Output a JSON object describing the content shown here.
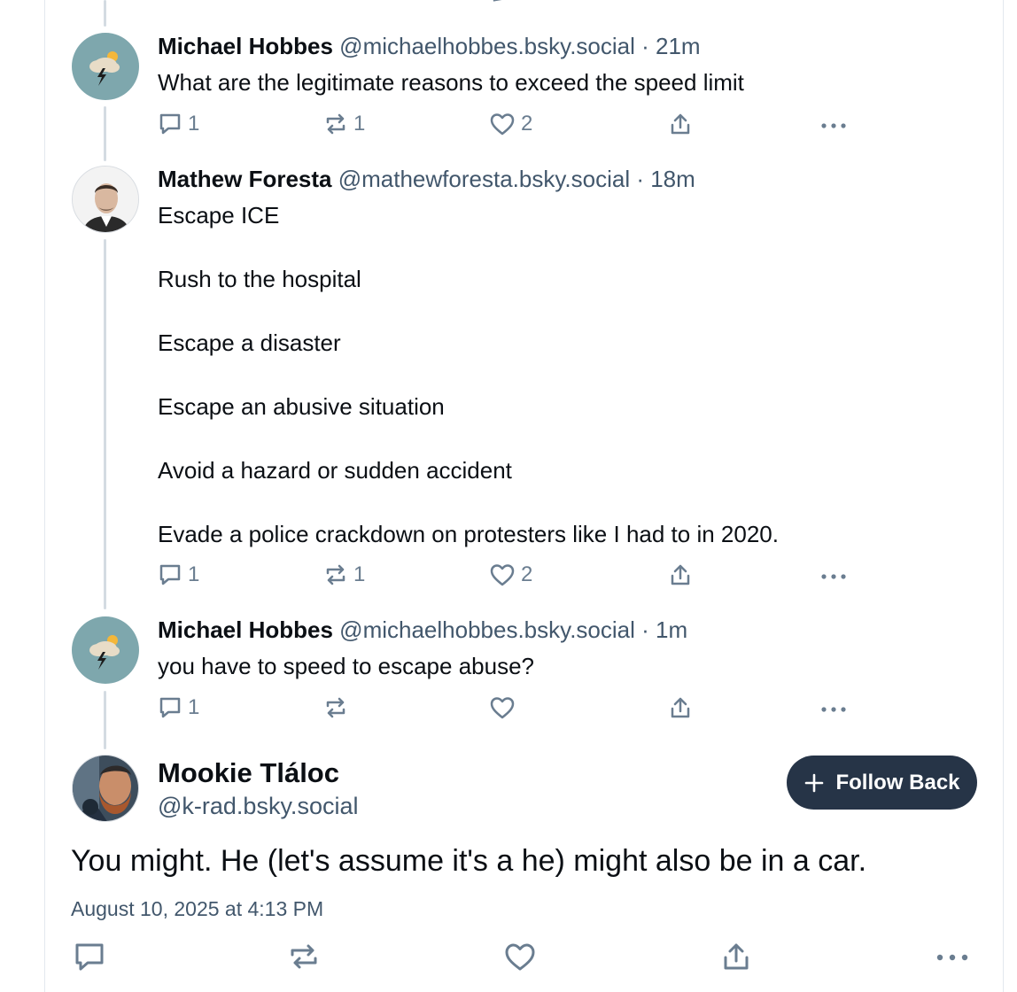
{
  "posts": [
    {
      "author": "Michael Hobbes",
      "handle": "@michaelhobbes.bsky.social",
      "time": "21m",
      "lines": [
        "What are the legitimate reasons to exceed the speed limit"
      ],
      "replies": "1",
      "reposts": "1",
      "likes": "2"
    },
    {
      "author": "Mathew Foresta",
      "handle": "@mathewforesta.bsky.social",
      "time": "18m",
      "lines": [
        "Escape ICE",
        "Rush to the hospital",
        "Escape a disaster",
        "Escape an abusive situation",
        "Avoid a hazard or sudden accident",
        "Evade a police crackdown on protesters like I had to in 2020."
      ],
      "replies": "1",
      "reposts": "1",
      "likes": "2"
    },
    {
      "author": "Michael Hobbes",
      "handle": "@michaelhobbes.bsky.social",
      "time": "1m",
      "lines": [
        "you have to speed to escape abuse?"
      ],
      "replies": "1",
      "reposts": "",
      "likes": ""
    }
  ],
  "focused_post": {
    "author": "Mookie Tláloc",
    "handle": "@k-rad.bsky.social",
    "follow_label": "Follow Back",
    "text": "You might.  He (let's assume it's a he) might also be in a car.",
    "date": "August 10, 2025 at 4:13 PM"
  },
  "separator": " · ",
  "icons": [
    "reply-icon",
    "repost-icon",
    "like-icon",
    "share-icon",
    "more-icon",
    "plus-icon"
  ]
}
